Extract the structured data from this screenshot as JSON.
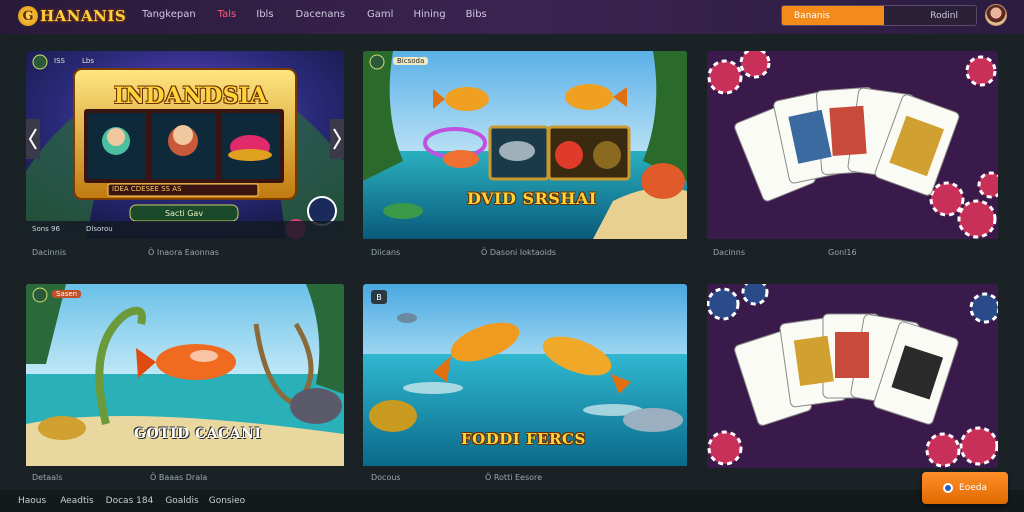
{
  "header": {
    "logo_mark": "G",
    "logo_text": "HANANIS",
    "nav": [
      {
        "label": "Tangkepan",
        "active": false
      },
      {
        "label": "Tals",
        "active": true
      },
      {
        "label": "Ibls",
        "active": false
      },
      {
        "label": "Dacenans",
        "active": false
      },
      {
        "label": "Gaml",
        "active": false
      },
      {
        "label": "Hining",
        "active": false
      },
      {
        "label": "Bibs",
        "active": false
      }
    ],
    "search_button": "Bananis",
    "search_right": "Rodinl"
  },
  "cards": [
    {
      "caption": "Dacinnis",
      "caption2": "Ö Inaora Eaonnas",
      "title": "INDANDSIA",
      "badge": "ISS",
      "badge2": "Lbs",
      "status": "Sons 96",
      "status2": "Dlsorou",
      "panel_label": "IDEA CDESEE SS AS",
      "button": "Sacti Gav"
    },
    {
      "caption": "Diicans",
      "caption2": "Ö Dasoni Ioktaoids",
      "title": "DVID SRSHAI",
      "badge": "Bicsoda"
    },
    {
      "caption": "Dacinns",
      "caption2": "Gonl16"
    },
    {
      "caption": "Detaals",
      "caption2": "Ö Baaas Drala",
      "title": "GOTID CACANI",
      "badge": "Sasen"
    },
    {
      "caption": "Docous",
      "caption2": "Ö Rotti Eesore",
      "title": "FODDI FERCS",
      "badge": "B"
    },
    {
      "caption": ""
    }
  ],
  "footer": [
    "Haous",
    "Aeadtis",
    "Docas 184",
    "Goaldis",
    "Gonsieo"
  ],
  "cta": "Eoeda"
}
